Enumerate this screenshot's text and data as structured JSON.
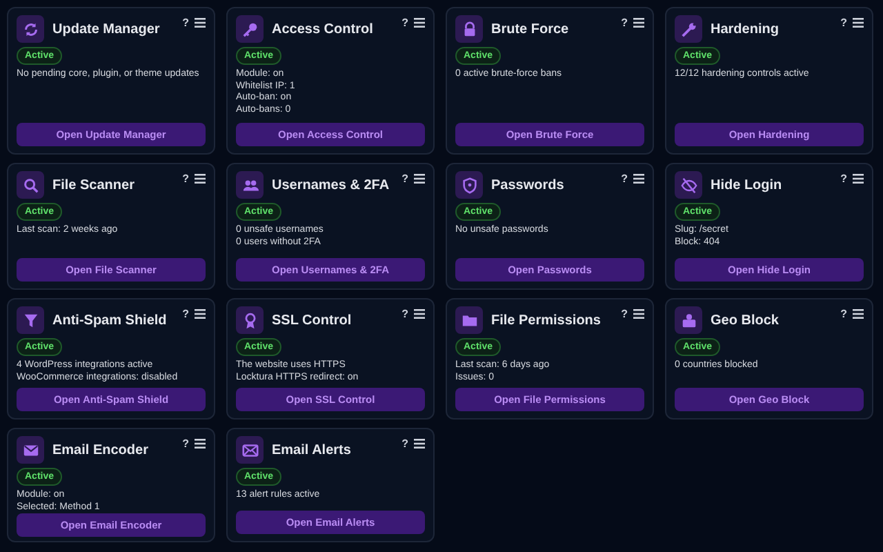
{
  "cards": [
    {
      "title": "Update Manager",
      "help": "?",
      "status": "Active",
      "active": true,
      "details": [
        "No pending core, plugin, or theme updates"
      ],
      "button": "Open Update Manager"
    },
    {
      "title": "Access Control",
      "help": "?",
      "status": "Active",
      "active": true,
      "details": [
        "Module: on",
        "Whitelist IP: 1",
        "Auto-ban: on",
        "Auto-bans: 0"
      ],
      "button": "Open Access Control"
    },
    {
      "title": "Brute Force",
      "help": "?",
      "status": "Active",
      "active": true,
      "details": [
        "0 active brute-force bans"
      ],
      "button": "Open Brute Force"
    },
    {
      "title": "Hardening",
      "help": "?",
      "status": "Active",
      "active": true,
      "details": [
        "12/12 hardening controls active"
      ],
      "button": "Open Hardening"
    },
    {
      "title": "File Scanner",
      "help": "?",
      "status": "Active",
      "active": true,
      "details": [
        "Last scan: 2 weeks ago"
      ],
      "button": "Open File Scanner"
    },
    {
      "title": "Usernames & 2FA",
      "help": "?",
      "status": "Active",
      "active": true,
      "details": [
        "0 unsafe usernames",
        "0 users without 2FA"
      ],
      "button": "Open Usernames & 2FA"
    },
    {
      "title": "Passwords",
      "help": "?",
      "status": "Active",
      "active": true,
      "details": [
        "No unsafe passwords"
      ],
      "button": "Open Passwords"
    },
    {
      "title": "Hide Login",
      "help": "?",
      "status": "Active",
      "active": true,
      "details": [
        "Slug: /secret",
        "Block: 404"
      ],
      "button": "Open Hide Login"
    },
    {
      "title": "Anti-Spam Shield",
      "help": "?",
      "status": "Active",
      "active": true,
      "details": [
        "4 WordPress integrations active",
        "WooCommerce integrations: disabled"
      ],
      "button": "Open Anti-Spam Shield"
    },
    {
      "title": "SSL Control",
      "help": "?",
      "status": "Active",
      "active": true,
      "details": [
        "The website uses HTTPS",
        "Locktura HTTPS redirect: on"
      ],
      "button": "Open SSL Control"
    },
    {
      "title": "File Permissions",
      "help": "?",
      "status": "Active",
      "active": true,
      "details": [
        "Last scan: 6 days ago",
        "Issues: 0"
      ],
      "button": "Open File Permissions"
    },
    {
      "title": "Geo Block",
      "help": "?",
      "status": "Active",
      "active": true,
      "details": [
        "0 countries blocked"
      ],
      "button": "Open Geo Block"
    },
    {
      "title": "Email Encoder",
      "help": "?",
      "status": "Active",
      "active": true,
      "details": [
        "Module: on",
        "Selected: Method 1"
      ],
      "button": "Open Email Encoder"
    },
    {
      "title": "Email Alerts",
      "help": "?",
      "status": "Active",
      "active": true,
      "details": [
        "13 alert rules active"
      ],
      "button": "Open Email Alerts"
    }
  ]
}
